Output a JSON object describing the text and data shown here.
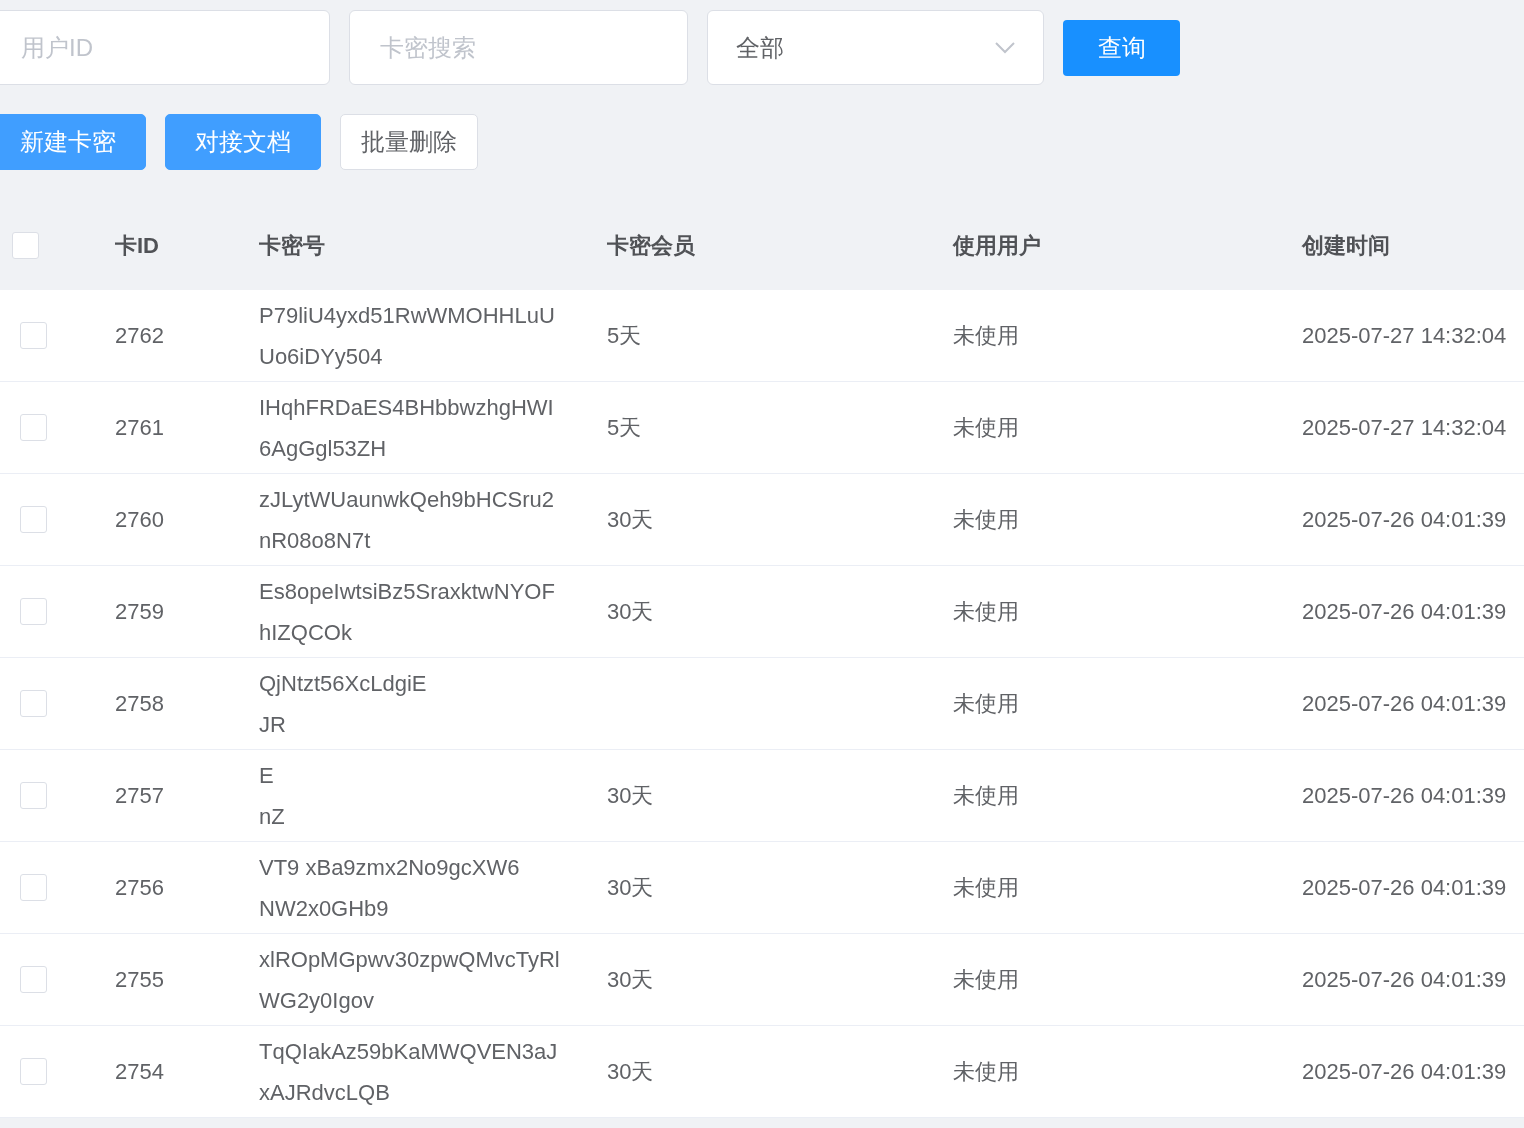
{
  "filters": {
    "user_id": {
      "placeholder": "用户ID"
    },
    "card_search": {
      "placeholder": "卡密搜索"
    },
    "type_select": {
      "value": "全部"
    },
    "query_button": "查询"
  },
  "actions": [
    {
      "label": "新建卡密",
      "kind": "primary"
    },
    {
      "label": "对接文档",
      "kind": "primary"
    },
    {
      "label": "批量删除",
      "kind": "default"
    }
  ],
  "table": {
    "select_all": {
      "checked": false
    },
    "columns": [
      "卡ID",
      "卡密号",
      "卡密会员",
      "使用用户",
      "创建时间"
    ],
    "rows": [
      {
        "checked": false,
        "id": "2762",
        "key": [
          "P79liU4yxd51RwWMOHHLuU",
          "Uo6iDYy504"
        ],
        "member": "5天",
        "user": "未使用",
        "created": "2025-07-27 14:32:04"
      },
      {
        "checked": false,
        "id": "2761",
        "key": [
          "IHqhFRDaES4BHbbwzhgHWI",
          "6AgGgl53ZH"
        ],
        "member": "5天",
        "user": "未使用",
        "created": "2025-07-27 14:32:04"
      },
      {
        "checked": false,
        "id": "2760",
        "key": [
          "zJLytWUaunwkQeh9bHCSru2",
          "nR08o8N7t"
        ],
        "member": "30天",
        "user": "未使用",
        "created": "2025-07-26 04:01:39"
      },
      {
        "checked": false,
        "id": "2759",
        "key": [
          "Es8opeIwtsiBz5SraxktwNYOF",
          "hIZQCOk"
        ],
        "member": "30天",
        "user": "未使用",
        "created": "2025-07-26 04:01:39"
      },
      {
        "checked": false,
        "id": "2758",
        "key": [
          "QjNtzt56XcLdgiE",
          "JR"
        ],
        "user": "未使用",
        "created": "2025-07-26 04:01:39"
      },
      {
        "checked": false,
        "id": "2757",
        "key": [
          "E",
          "nZ"
        ],
        "member": "30天",
        "user": "未使用",
        "created": "2025-07-26 04:01:39"
      },
      {
        "checked": false,
        "id": "2756",
        "key": [
          "VT9 xBa9zmx2No9gcXW6",
          "NW2x0GHb9"
        ],
        "member": "30天",
        "user": "未使用",
        "created": "2025-07-26 04:01:39"
      },
      {
        "checked": false,
        "id": "2755",
        "key": [
          "xlROpMGpwv30zpwQMvcTyRl",
          "WG2y0Igov"
        ],
        "member": "30天",
        "user": "未使用",
        "created": "2025-07-26 04:01:39"
      },
      {
        "checked": false,
        "id": "2754",
        "key": [
          "TqQIakAz59bKaMWQVEN3aJ",
          "xAJRdvcLQB"
        ],
        "member": "30天",
        "user": "未使用",
        "created": "2025-07-26 04:01:39"
      }
    ]
  }
}
